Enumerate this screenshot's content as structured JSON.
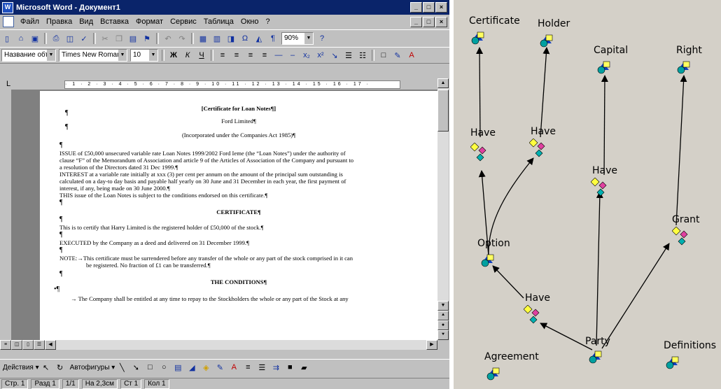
{
  "word": {
    "title": "Microsoft Word - Документ1",
    "menu": [
      "Файл",
      "Правка",
      "Вид",
      "Вставка",
      "Формат",
      "Сервис",
      "Таблица",
      "Окно",
      "?"
    ],
    "style_value": "Название объек",
    "font_value": "Times New Roman",
    "size_value": "10",
    "zoom_value": "90%",
    "ruler_text": "· 1 · 2 · 3 · 4 · 5 · 6 · 7 · 8 · 9 · 10 · 11 · 12 · 13 · 14 · 15 · 16 · 17 ·",
    "document": {
      "title": "[Certificate for Loan Notes¶]",
      "company": "Ford Limited¶",
      "incorporated": "(Incorporated under the Companies Act 1985)¶",
      "para1": [
        "ISSUE of £50,000 unsecured variable rate Loan Notes 1999/2002 Ford Ieme (the “Loan Notes”) under the authority of",
        "clause “F” of the Memorandum of Association and article 9 of the Articles of Association of the Company and pursuant to",
        "a resolution of the Directors dated 31 Dec 1999.¶"
      ],
      "para2": [
        "INTEREST at a variable rate initially at xxx (3) per cent per annum on the amount of the principal sum outstanding is",
        "calculated on a day-to day basis and payable half yearly on 30 June and 31 December in each year, the first payment of",
        "interest, if any, being made on 30 June 2000.¶"
      ],
      "para3": "THIS issue of the Loan Notes is subject to the conditions endorsed on this certificate.¶",
      "certificate_heading": "CERTIFICATE¶",
      "certify": "This is to certify that Harry Limited is the registered holder of £50,000 of the stock.¶",
      "executed": "EXECUTED by the Company as a deed and delivered on 31 December 1999.¶",
      "note": [
        "NOTE:→This certificate must be surrendered before any transfer of the whole or any part of the stock comprised in it can",
        "be registered. No fraction of £1 can be transferred.¶"
      ],
      "conditions_heading": "THE CONDITIONS¶",
      "condition1": "→ The Company shall be entitled at any time to repay to the Stockholders the whole or any part of the Stock at any",
      "pilcrow": "¶",
      "bullet_mark": "•¶"
    },
    "drawbar": {
      "draw_label": "Действия ▾",
      "autoshapes_label": "Автофигуры ▾"
    },
    "status": [
      "Стр. 1",
      "Разд 1",
      "1/1",
      "На 2,3см",
      "Ст 1",
      "Кол 1"
    ]
  },
  "graph": {
    "nodes": {
      "certificate": "Certificate",
      "holder": "Holder",
      "capital": "Capital",
      "right": "Right",
      "option": "Option",
      "party": "Party",
      "agreement": "Agreement",
      "definitions": "Definitions"
    },
    "relations": {
      "have1": "Have",
      "have2": "Have",
      "have3": "Have",
      "have4": "Have",
      "grant": "Grant"
    }
  }
}
